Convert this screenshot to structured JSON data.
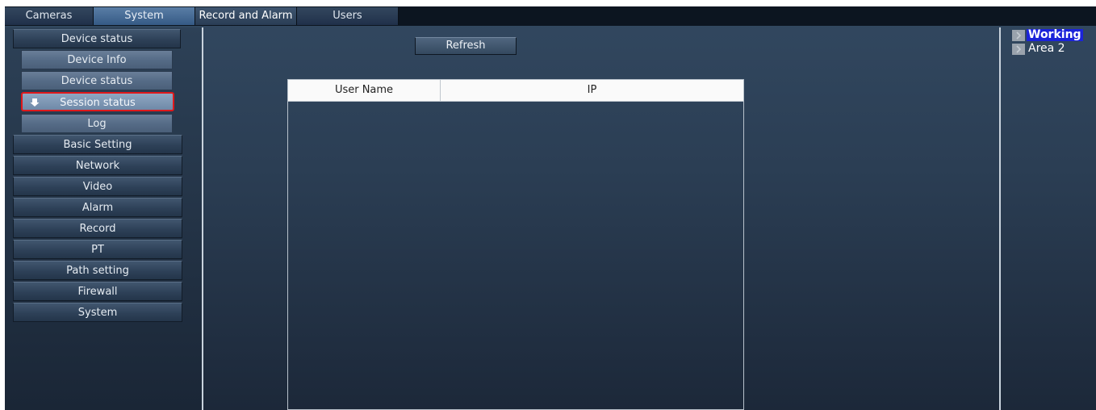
{
  "tabs": [
    {
      "label": "Cameras"
    },
    {
      "label": "System"
    },
    {
      "label": "Record and Alarm"
    },
    {
      "label": "Users"
    }
  ],
  "sidebar": {
    "items": [
      {
        "label": "Device status"
      },
      {
        "label": "Device Info"
      },
      {
        "label": "Device status"
      },
      {
        "label": "Session status"
      },
      {
        "label": "Log"
      },
      {
        "label": "Basic Setting"
      },
      {
        "label": "Network"
      },
      {
        "label": "Video"
      },
      {
        "label": "Alarm"
      },
      {
        "label": "Record"
      },
      {
        "label": "PT"
      },
      {
        "label": "Path setting"
      },
      {
        "label": "Firewall"
      },
      {
        "label": "System"
      }
    ],
    "selected_icon": "down-arrow-icon"
  },
  "main": {
    "refresh_label": "Refresh",
    "table": {
      "columns": [
        "User Name",
        "IP"
      ],
      "rows": []
    }
  },
  "right": {
    "working_label": "Working",
    "area_label": "Area 2",
    "icon": "area-arrow-icon"
  },
  "colors": {
    "selection_border": "#e0181b",
    "working_highlight": "#1b23d9"
  }
}
